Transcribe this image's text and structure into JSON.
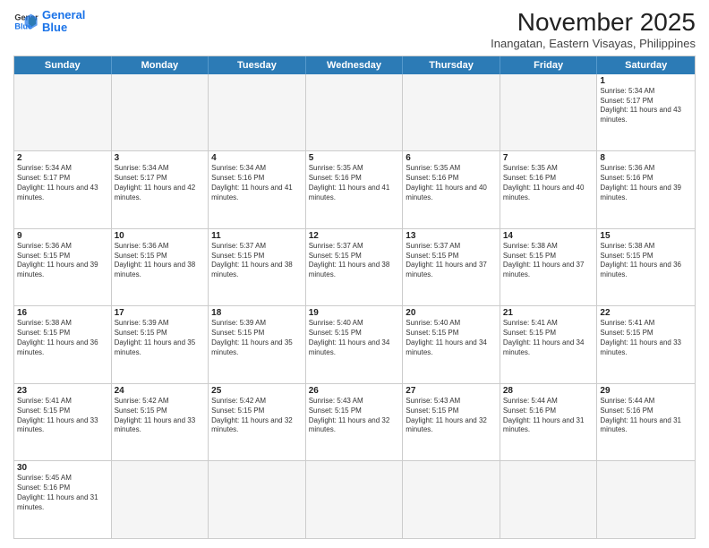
{
  "logo": {
    "line1": "General",
    "line2": "Blue"
  },
  "title": "November 2025",
  "subtitle": "Inangatan, Eastern Visayas, Philippines",
  "dayNames": [
    "Sunday",
    "Monday",
    "Tuesday",
    "Wednesday",
    "Thursday",
    "Friday",
    "Saturday"
  ],
  "rows": [
    [
      {
        "date": "",
        "text": ""
      },
      {
        "date": "",
        "text": ""
      },
      {
        "date": "",
        "text": ""
      },
      {
        "date": "",
        "text": ""
      },
      {
        "date": "",
        "text": ""
      },
      {
        "date": "",
        "text": ""
      },
      {
        "date": "1",
        "text": "Sunrise: 5:34 AM\nSunset: 5:17 PM\nDaylight: 11 hours and 43 minutes."
      }
    ],
    [
      {
        "date": "2",
        "text": "Sunrise: 5:34 AM\nSunset: 5:17 PM\nDaylight: 11 hours and 43 minutes."
      },
      {
        "date": "3",
        "text": "Sunrise: 5:34 AM\nSunset: 5:17 PM\nDaylight: 11 hours and 42 minutes."
      },
      {
        "date": "4",
        "text": "Sunrise: 5:34 AM\nSunset: 5:16 PM\nDaylight: 11 hours and 41 minutes."
      },
      {
        "date": "5",
        "text": "Sunrise: 5:35 AM\nSunset: 5:16 PM\nDaylight: 11 hours and 41 minutes."
      },
      {
        "date": "6",
        "text": "Sunrise: 5:35 AM\nSunset: 5:16 PM\nDaylight: 11 hours and 40 minutes."
      },
      {
        "date": "7",
        "text": "Sunrise: 5:35 AM\nSunset: 5:16 PM\nDaylight: 11 hours and 40 minutes."
      },
      {
        "date": "8",
        "text": "Sunrise: 5:36 AM\nSunset: 5:16 PM\nDaylight: 11 hours and 39 minutes."
      }
    ],
    [
      {
        "date": "9",
        "text": "Sunrise: 5:36 AM\nSunset: 5:15 PM\nDaylight: 11 hours and 39 minutes."
      },
      {
        "date": "10",
        "text": "Sunrise: 5:36 AM\nSunset: 5:15 PM\nDaylight: 11 hours and 38 minutes."
      },
      {
        "date": "11",
        "text": "Sunrise: 5:37 AM\nSunset: 5:15 PM\nDaylight: 11 hours and 38 minutes."
      },
      {
        "date": "12",
        "text": "Sunrise: 5:37 AM\nSunset: 5:15 PM\nDaylight: 11 hours and 38 minutes."
      },
      {
        "date": "13",
        "text": "Sunrise: 5:37 AM\nSunset: 5:15 PM\nDaylight: 11 hours and 37 minutes."
      },
      {
        "date": "14",
        "text": "Sunrise: 5:38 AM\nSunset: 5:15 PM\nDaylight: 11 hours and 37 minutes."
      },
      {
        "date": "15",
        "text": "Sunrise: 5:38 AM\nSunset: 5:15 PM\nDaylight: 11 hours and 36 minutes."
      }
    ],
    [
      {
        "date": "16",
        "text": "Sunrise: 5:38 AM\nSunset: 5:15 PM\nDaylight: 11 hours and 36 minutes."
      },
      {
        "date": "17",
        "text": "Sunrise: 5:39 AM\nSunset: 5:15 PM\nDaylight: 11 hours and 35 minutes."
      },
      {
        "date": "18",
        "text": "Sunrise: 5:39 AM\nSunset: 5:15 PM\nDaylight: 11 hours and 35 minutes."
      },
      {
        "date": "19",
        "text": "Sunrise: 5:40 AM\nSunset: 5:15 PM\nDaylight: 11 hours and 34 minutes."
      },
      {
        "date": "20",
        "text": "Sunrise: 5:40 AM\nSunset: 5:15 PM\nDaylight: 11 hours and 34 minutes."
      },
      {
        "date": "21",
        "text": "Sunrise: 5:41 AM\nSunset: 5:15 PM\nDaylight: 11 hours and 34 minutes."
      },
      {
        "date": "22",
        "text": "Sunrise: 5:41 AM\nSunset: 5:15 PM\nDaylight: 11 hours and 33 minutes."
      }
    ],
    [
      {
        "date": "23",
        "text": "Sunrise: 5:41 AM\nSunset: 5:15 PM\nDaylight: 11 hours and 33 minutes."
      },
      {
        "date": "24",
        "text": "Sunrise: 5:42 AM\nSunset: 5:15 PM\nDaylight: 11 hours and 33 minutes."
      },
      {
        "date": "25",
        "text": "Sunrise: 5:42 AM\nSunset: 5:15 PM\nDaylight: 11 hours and 32 minutes."
      },
      {
        "date": "26",
        "text": "Sunrise: 5:43 AM\nSunset: 5:15 PM\nDaylight: 11 hours and 32 minutes."
      },
      {
        "date": "27",
        "text": "Sunrise: 5:43 AM\nSunset: 5:15 PM\nDaylight: 11 hours and 32 minutes."
      },
      {
        "date": "28",
        "text": "Sunrise: 5:44 AM\nSunset: 5:16 PM\nDaylight: 11 hours and 31 minutes."
      },
      {
        "date": "29",
        "text": "Sunrise: 5:44 AM\nSunset: 5:16 PM\nDaylight: 11 hours and 31 minutes."
      }
    ],
    [
      {
        "date": "30",
        "text": "Sunrise: 5:45 AM\nSunset: 5:16 PM\nDaylight: 11 hours and 31 minutes."
      },
      {
        "date": "",
        "text": ""
      },
      {
        "date": "",
        "text": ""
      },
      {
        "date": "",
        "text": ""
      },
      {
        "date": "",
        "text": ""
      },
      {
        "date": "",
        "text": ""
      },
      {
        "date": "",
        "text": ""
      }
    ]
  ]
}
